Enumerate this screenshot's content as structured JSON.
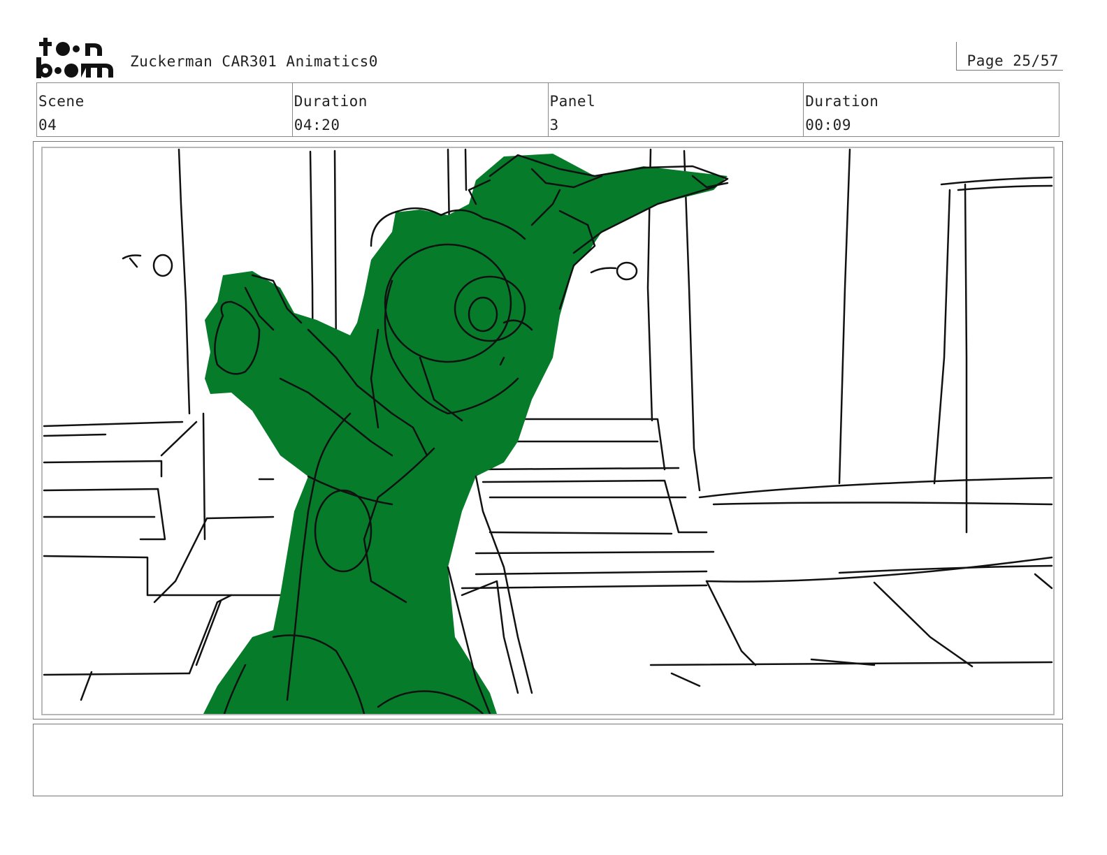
{
  "header": {
    "logo_text": "toon boom",
    "title": "Zuckerman CAR301 Animatics0",
    "page_label": "Page 25/57"
  },
  "info": {
    "scene_label": "Scene",
    "scene_value": "04",
    "duration_label": "Duration",
    "duration_value": "04:20",
    "panel_label": "Panel",
    "panel_value": "3",
    "panel_duration_label": "Duration",
    "panel_duration_value": "00:09"
  },
  "panel": {
    "fill_color": "#067b2a",
    "line_color": "#111111"
  },
  "notes": {
    "text": ""
  }
}
